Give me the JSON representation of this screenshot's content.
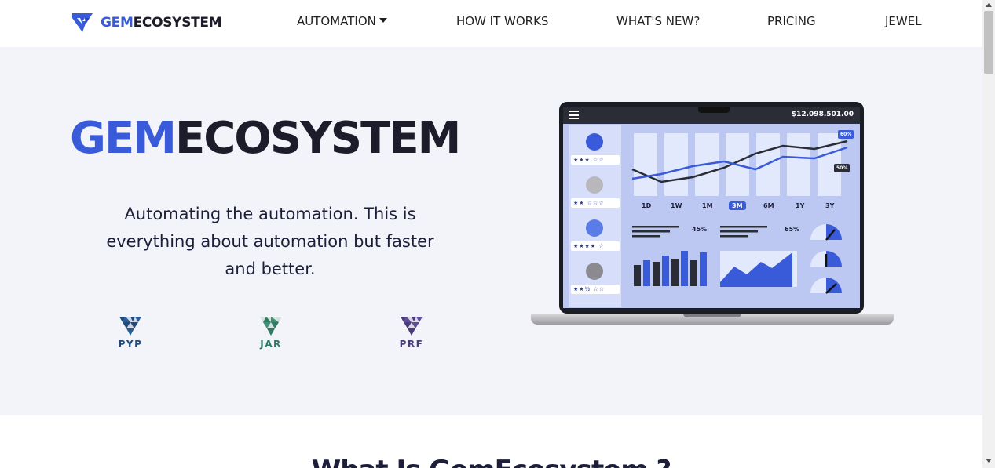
{
  "nav": {
    "logo": {
      "gem": "GEM",
      "eco": "ECOSYSTEM",
      "icon": "gem-logo-icon"
    },
    "items": [
      {
        "label": "AUTOMATION",
        "has_dropdown": true
      },
      {
        "label": "HOW IT WORKS"
      },
      {
        "label": "WHAT'S NEW?"
      },
      {
        "label": "PRICING"
      },
      {
        "label": "JEWEL"
      }
    ]
  },
  "hero": {
    "title_gem": "GEM",
    "title_eco": "ECOSYSTEM",
    "tagline": "Automating the automation. This is everything about automation but faster and better.",
    "brands": [
      {
        "name": "PYP",
        "color": "#1f4a7a",
        "icon": "diamond-icon"
      },
      {
        "name": "JAR",
        "color": "#2f7a64",
        "icon": "diamond-icon"
      },
      {
        "name": "PRF",
        "color": "#4a3d7a",
        "icon": "diamond-icon"
      }
    ]
  },
  "dashboard": {
    "balance": "$12.098.501.00",
    "periods": [
      "1D",
      "1W",
      "1M",
      "3M",
      "6M",
      "1Y",
      "3Y"
    ],
    "active_period": "3M",
    "badge_top": "60%",
    "badge_bottom": "50%",
    "stat_left": "45%",
    "stat_right": "65%"
  },
  "section2": {
    "title": "What Is GemEcosystem ?"
  },
  "colors": {
    "brand_blue": "#3a5bd9",
    "dark": "#1c1c2a",
    "hero_bg": "#f2f4f9"
  }
}
